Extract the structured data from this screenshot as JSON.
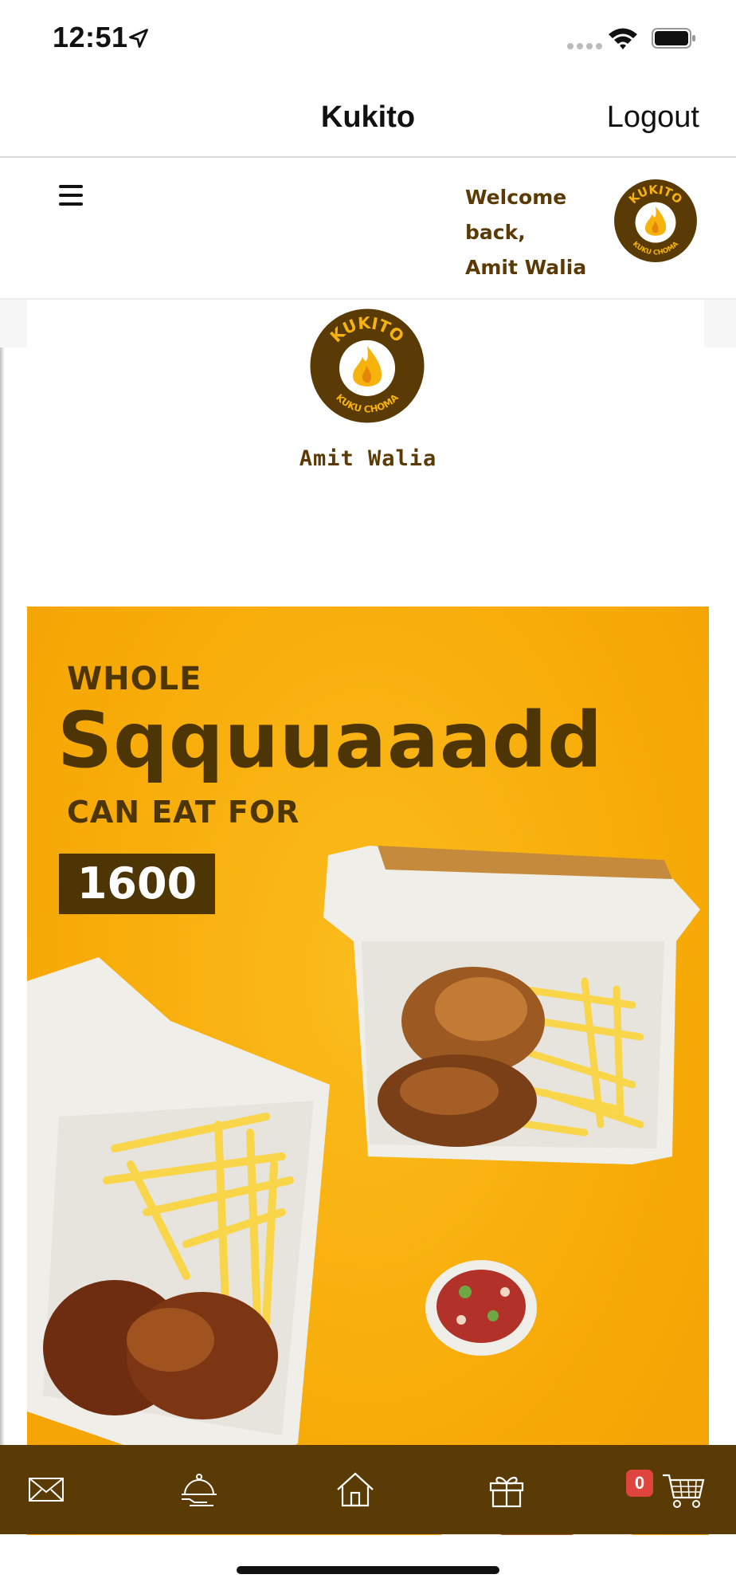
{
  "status_bar": {
    "time": "12:51"
  },
  "nav": {
    "title": "Kukito",
    "logout_label": "Logout"
  },
  "header": {
    "welcome_line1": "Welcome back,",
    "welcome_line2": "Amit Walia"
  },
  "logo": {
    "top_text": "KUKITO",
    "bottom_text": "KUKU CHOMA"
  },
  "profile": {
    "name": "Amit Walia"
  },
  "banner": {
    "line1": "WHOLE",
    "line2": "Sqquuaaadd",
    "line3": "CAN EAT FOR",
    "price": "1600"
  },
  "tabs": [
    {
      "icon": "mail-icon"
    },
    {
      "icon": "food-tray-icon"
    },
    {
      "icon": "home-icon"
    },
    {
      "icon": "gift-icon"
    },
    {
      "icon": "cart-icon"
    }
  ],
  "cart": {
    "count": "0"
  },
  "colors": {
    "brand_brown": "#5a3b05",
    "banner_orange": "#f8ae0c",
    "badge_red": "#e0443f"
  }
}
